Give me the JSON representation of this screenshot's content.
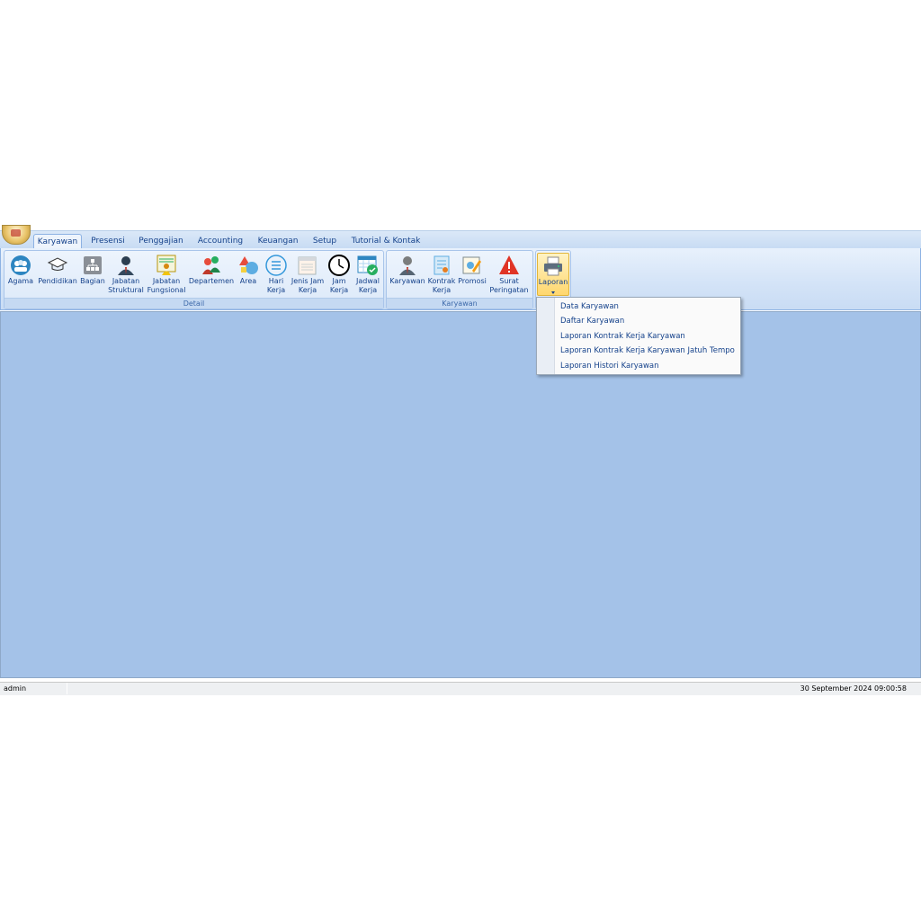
{
  "ribbon": {
    "tabs": [
      "Karyawan",
      "Presensi",
      "Penggajian",
      "Accounting",
      "Keuangan",
      "Setup",
      "Tutorial & Kontak"
    ],
    "active_tab": "Karyawan",
    "groups": {
      "detail": {
        "caption": "Detail",
        "buttons": [
          "Agama",
          "Pendidikan",
          "Bagian",
          "Jabatan\nStruktural",
          "Jabatan\nFungsional",
          "Departemen",
          "Area",
          "Hari\nKerja",
          "Jenis Jam\nKerja",
          "Jam\nKerja",
          "Jadwal\nKerja"
        ]
      },
      "karyawan": {
        "caption": "Karyawan",
        "buttons": [
          "Karyawan",
          "Kontrak\nKerja",
          "Promosi",
          "Surat\nPeringatan"
        ]
      },
      "laporan": {
        "button": "Laporan"
      }
    }
  },
  "dropdown": {
    "items": [
      "Data Karyawan",
      "Daftar Karyawan",
      "Laporan Kontrak Kerja Karyawan",
      "Laporan Kontrak Kerja Karyawan Jatuh Tempo",
      "Laporan Histori Karyawan"
    ]
  },
  "statusbar": {
    "user": "admin",
    "datetime": "30 September 2024  09:00:58"
  },
  "colors": {
    "workspace": "#a4c2e8",
    "ribbon_text": "#15428b",
    "laporan_highlight": "#ffd76e"
  }
}
